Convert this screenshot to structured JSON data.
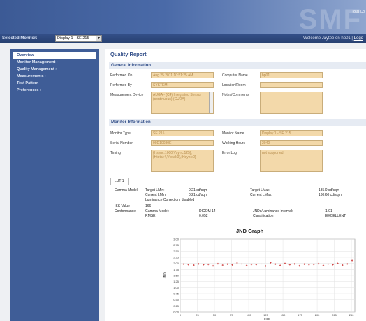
{
  "banner": {
    "logo": "SMF",
    "right_text": "Total Co"
  },
  "topbar": {
    "selected_label": "Selected Monitor:",
    "selected_value": "Display 1 - SE 215",
    "welcome_text": "Welcome Jaytee on hp01 |",
    "logout_label": "Logo"
  },
  "nav": [
    {
      "label": "Overview"
    },
    {
      "label": "Monitor Management ›"
    },
    {
      "label": "Quality Management ›"
    },
    {
      "label": "Measurements ›"
    },
    {
      "label": "Test Pattern"
    },
    {
      "label": "Preferences ›"
    }
  ],
  "page": {
    "title": "Quality Report"
  },
  "general": {
    "heading": "General Information",
    "performed_on_label": "Performed On",
    "performed_on": "Aug 25 2011 10:51:25 AM",
    "performed_by_label": "Performed By",
    "performed_by": "SYSTEM",
    "measurement_device_label": "Measurement Device",
    "measurement_device": "AUGA - (C4) Integrated Sensor (continuous) (CUDA)",
    "computer_name_label": "Computer Name",
    "computer_name": "hp01",
    "location_label": "Location/Room",
    "location": "",
    "notes_label": "Notes/Comments",
    "notes": ""
  },
  "monitor": {
    "heading": "Monitor Information",
    "type_label": "Monitor Type",
    "type": "SE 215",
    "serial_label": "Serial Number",
    "serial": "99D10030E",
    "timing_label": "Timing",
    "timing": "{Hsync:1000,Vsync:125},{Htotal:4,Vtotal:0},{Hsync:0}",
    "name_label": "Monitor Name",
    "name": "Display 1 - SE 215",
    "hours_label": "Working Hours",
    "hours": "2040",
    "error_label": "Error Log",
    "error": "not supported"
  },
  "results": {
    "tab": "LUT 1",
    "gamma_model_label": "Gamma Model",
    "target_lmin_label": "Target LMin:",
    "target_lmin": "0.21 cd/sqm",
    "current_lmin_label": "Current LMin:",
    "current_lmin": "0.21 cd/sqm",
    "lum_correction": "Luminance Correction: disabled",
    "target_lmax_label": "Target LMax:",
    "target_lmax": "135.0 cd/sqm",
    "current_lmax_label": "Current LMax:",
    "current_lmax": "130.60 cd/sqm",
    "iss_label": "ISS Value",
    "iss": "166",
    "conformance_label": "Conformance",
    "gamma_model2_label": "Gamma Model:",
    "gamma_model2": "DICOM 14",
    "rmse_label": "RMSE:",
    "rmse": "0.052",
    "jnd_interval_label": "JNDs/Luminance Interval:",
    "jnd_interval": "1.01",
    "classification_label": "Classification:",
    "classification": "EXCELLENT"
  },
  "chart_data": {
    "type": "scatter",
    "title": "JND Graph",
    "ylabel": "JND",
    "xlabel": "DDL",
    "ylim": [
      0,
      3.0
    ],
    "xlim": [
      0,
      255
    ],
    "yticks": [
      "3.00",
      "2.75",
      "2.50",
      "2.25",
      "2.00",
      "1.75",
      "1.50",
      "1.25",
      "1.00",
      "0.75",
      "0.50",
      "0.25",
      "0.00"
    ],
    "xticks": [
      "0",
      "25",
      "50",
      "75",
      "100",
      "125",
      "150",
      "175",
      "200",
      "225",
      "250"
    ],
    "grid": true,
    "color": "#cc3333",
    "x": [
      5,
      12,
      20,
      27,
      34,
      41,
      48,
      55,
      62,
      69,
      76,
      83,
      90,
      97,
      104,
      111,
      118,
      125,
      132,
      139,
      146,
      153,
      160,
      167,
      174,
      181,
      188,
      195,
      202,
      209,
      216,
      223,
      230,
      237,
      244,
      251
    ],
    "y": [
      1.97,
      1.95,
      1.93,
      1.98,
      1.95,
      1.96,
      1.9,
      1.99,
      1.93,
      1.97,
      1.94,
      2.02,
      1.98,
      1.92,
      1.96,
      1.95,
      1.98,
      1.89,
      2.03,
      1.97,
      1.92,
      2.0,
      1.95,
      1.98,
      1.9,
      1.97,
      1.94,
      1.96,
      1.99,
      1.92,
      1.97,
      1.95,
      2.0,
      1.93,
      1.98,
      2.12
    ]
  }
}
